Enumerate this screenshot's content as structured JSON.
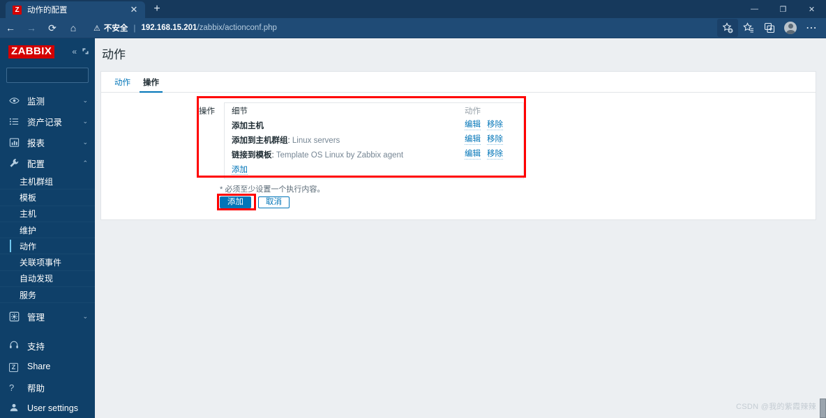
{
  "browser": {
    "tab": {
      "title": "动作的配置",
      "favicon_letter": "Z",
      "close_label": "✕"
    },
    "new_tab_label": "+",
    "window_controls": {
      "minimize": "—",
      "maximize": "❐",
      "close": "✕"
    },
    "nav": {
      "back": "←",
      "forward": "→",
      "reload": "⟳",
      "home": "⌂"
    },
    "address": {
      "warning_icon": "⚠",
      "security_label": "不安全",
      "divider": "|",
      "url_host": "192.168.15.201",
      "url_path": "/zabbix/actionconf.php"
    },
    "toolbar_icons": [
      {
        "name": "favorite-add-icon",
        "glyph": "☆"
      },
      {
        "name": "collections-icon",
        "glyph": "☆"
      },
      {
        "name": "browser-essentials-icon",
        "glyph": "❏"
      },
      {
        "name": "profile-avatar",
        "glyph": ""
      },
      {
        "name": "settings-more-icon",
        "glyph": "⋯"
      }
    ]
  },
  "sidebar": {
    "logo": "ZABBIX",
    "collapse_icon": "«",
    "expand_icon": "⬒",
    "search": {
      "value": "",
      "placeholder": "",
      "icon": "search-icon"
    },
    "sections": [
      {
        "id": "monitoring",
        "label": "监测",
        "icon": "eye-icon",
        "chevron": "⌄",
        "expanded": false
      },
      {
        "id": "inventory",
        "label": "资产记录",
        "icon": "list-icon",
        "chevron": "⌄",
        "expanded": false
      },
      {
        "id": "reports",
        "label": "报表",
        "icon": "bar-chart-icon",
        "chevron": "⌄",
        "expanded": false
      },
      {
        "id": "configuration",
        "label": "配置",
        "icon": "wrench-icon",
        "chevron": "⌃",
        "expanded": true
      }
    ],
    "configuration_items": [
      {
        "label": "主机群组",
        "active": false
      },
      {
        "label": "模板",
        "active": false
      },
      {
        "label": "主机",
        "active": false
      },
      {
        "label": "维护",
        "active": false
      },
      {
        "label": "动作",
        "active": true
      },
      {
        "label": "关联项事件",
        "active": false
      },
      {
        "label": "自动发现",
        "active": false
      },
      {
        "label": "服务",
        "active": false
      }
    ],
    "administration": {
      "id": "administration",
      "label": "管理",
      "icon": "gear-icon",
      "chevron": "⌄"
    },
    "footer_items": [
      {
        "label": "支持",
        "icon": "headset-icon"
      },
      {
        "label": "Share",
        "icon": "zabbix-share-icon"
      },
      {
        "label": "帮助",
        "icon": "question-icon"
      },
      {
        "label": "User settings",
        "icon": "user-icon"
      }
    ]
  },
  "main": {
    "page_title": "动作",
    "tabs": [
      {
        "label": "动作",
        "active": false
      },
      {
        "label": "操作",
        "active": true
      }
    ],
    "operations": {
      "section_label": "操作",
      "columns": {
        "detail": "细节",
        "action": "动作"
      },
      "rows": [
        {
          "name": "添加主机",
          "value": "",
          "edit": "编辑",
          "remove": "移除"
        },
        {
          "name": "添加到主机群组",
          "value": "Linux servers",
          "edit": "编辑",
          "remove": "移除"
        },
        {
          "name": "链接到模板",
          "value": "Template OS Linux by Zabbix agent",
          "edit": "编辑",
          "remove": "移除"
        }
      ],
      "add_link": "添加"
    },
    "required_note": "必须至少设置一个执行内容。",
    "required_star": "*",
    "buttons": {
      "submit": "添加",
      "cancel": "取消"
    }
  },
  "watermark": "CSDN @我的紫霞辣辣",
  "colors": {
    "zabbix_red": "#d40000",
    "sidebar_blue": "#0f4069",
    "link_blue": "#0275b8",
    "highlight_red": "#ff0000",
    "browser_chrome": "#1f4b76"
  }
}
